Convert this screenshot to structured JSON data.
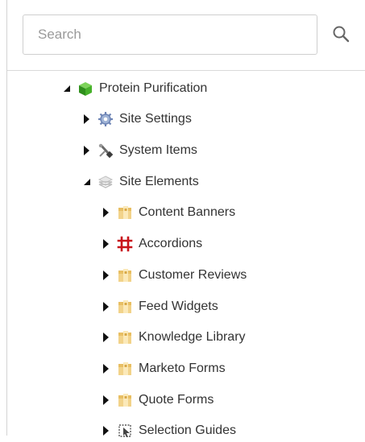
{
  "search": {
    "placeholder": "Search",
    "value": ""
  },
  "tree": {
    "root": {
      "label": "Protein Purification",
      "icon": "green-cube-icon",
      "expanded": true
    },
    "children": [
      {
        "label": "Site Settings",
        "icon": "gear-icon",
        "expanded": false
      },
      {
        "label": "System Items",
        "icon": "tools-icon",
        "expanded": false
      },
      {
        "label": "Site Elements",
        "icon": "stacked-sheets-icon",
        "expanded": true,
        "children": [
          {
            "label": "Content Banners",
            "icon": "folder-icon"
          },
          {
            "label": "Accordions",
            "icon": "red-grid-icon"
          },
          {
            "label": "Customer Reviews",
            "icon": "folder-icon"
          },
          {
            "label": "Feed Widgets",
            "icon": "folder-icon"
          },
          {
            "label": "Knowledge Library",
            "icon": "folder-icon"
          },
          {
            "label": "Marketo Forms",
            "icon": "folder-icon"
          },
          {
            "label": "Quote Forms",
            "icon": "folder-icon"
          },
          {
            "label": "Selection Guides",
            "icon": "selection-guide-icon"
          }
        ]
      }
    ]
  }
}
